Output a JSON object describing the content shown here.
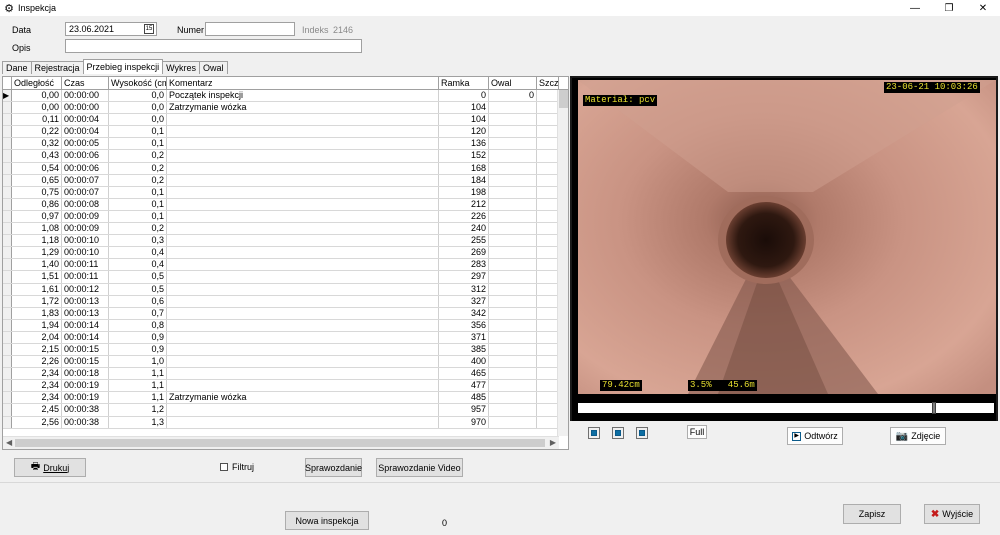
{
  "window": {
    "title": "Inspekcja",
    "minimize": "—",
    "restore": "❐",
    "close": "✕"
  },
  "header": {
    "data_label": "Data",
    "data_value": "23.06.2021",
    "numer_label": "Numer",
    "numer_value": "",
    "indeks_label": "Indeks",
    "indeks_value": "2146",
    "opis_label": "Opis",
    "opis_value": ""
  },
  "tabs": [
    "Dane",
    "Rejestracja",
    "Przebieg inspekcji",
    "Wykres",
    "Owal"
  ],
  "grid": {
    "columns": [
      "Odległość",
      "Czas",
      "Wysokość (cm)",
      "Komentarz",
      "Ramka",
      "Owal",
      "Szcz"
    ],
    "rows": [
      [
        "0,00",
        "00:00:00",
        "0,0",
        "Początek inspekcji",
        "0",
        "0"
      ],
      [
        "0,00",
        "00:00:00",
        "0,0",
        "Zatrzymanie wózka",
        "104",
        ""
      ],
      [
        "0,11",
        "00:00:04",
        "0,0",
        "",
        "104",
        ""
      ],
      [
        "0,22",
        "00:00:04",
        "0,1",
        "",
        "120",
        ""
      ],
      [
        "0,32",
        "00:00:05",
        "0,1",
        "",
        "136",
        ""
      ],
      [
        "0,43",
        "00:00:06",
        "0,2",
        "",
        "152",
        ""
      ],
      [
        "0,54",
        "00:00:06",
        "0,2",
        "",
        "168",
        ""
      ],
      [
        "0,65",
        "00:00:07",
        "0,2",
        "",
        "184",
        ""
      ],
      [
        "0,75",
        "00:00:07",
        "0,1",
        "",
        "198",
        ""
      ],
      [
        "0,86",
        "00:00:08",
        "0,1",
        "",
        "212",
        ""
      ],
      [
        "0,97",
        "00:00:09",
        "0,1",
        "",
        "226",
        ""
      ],
      [
        "1,08",
        "00:00:09",
        "0,2",
        "",
        "240",
        ""
      ],
      [
        "1,18",
        "00:00:10",
        "0,3",
        "",
        "255",
        ""
      ],
      [
        "1,29",
        "00:00:10",
        "0,4",
        "",
        "269",
        ""
      ],
      [
        "1,40",
        "00:00:11",
        "0,4",
        "",
        "283",
        ""
      ],
      [
        "1,51",
        "00:00:11",
        "0,5",
        "",
        "297",
        ""
      ],
      [
        "1,61",
        "00:00:12",
        "0,5",
        "",
        "312",
        ""
      ],
      [
        "1,72",
        "00:00:13",
        "0,6",
        "",
        "327",
        ""
      ],
      [
        "1,83",
        "00:00:13",
        "0,7",
        "",
        "342",
        ""
      ],
      [
        "1,94",
        "00:00:14",
        "0,8",
        "",
        "356",
        ""
      ],
      [
        "2,04",
        "00:00:14",
        "0,9",
        "",
        "371",
        ""
      ],
      [
        "2,15",
        "00:00:15",
        "0,9",
        "",
        "385",
        ""
      ],
      [
        "2,26",
        "00:00:15",
        "1,0",
        "",
        "400",
        ""
      ],
      [
        "2,34",
        "00:00:18",
        "1,1",
        "",
        "465",
        ""
      ],
      [
        "2,34",
        "00:00:19",
        "1,1",
        "",
        "477",
        ""
      ],
      [
        "2,34",
        "00:00:19",
        "1,1",
        "Zatrzymanie wózka",
        "485",
        ""
      ],
      [
        "2,45",
        "00:00:38",
        "1,2",
        "",
        "957",
        ""
      ],
      [
        "2,56",
        "00:00:38",
        "1,3",
        "",
        "970",
        ""
      ]
    ]
  },
  "video": {
    "material": "Materiał: pcv",
    "timestamp": "23-06-21 10:03:26",
    "distance": "79.42cm",
    "slope": "3.5%   45.6m",
    "seek_fraction": 0.86
  },
  "video_controls": {
    "full_label": "Full",
    "odtworz_label": "Odtwórz",
    "zdjecie_label": "Zdjęcie"
  },
  "bottom": {
    "drukuj_label": "Drukuj",
    "filtruj_label": "Filtruj",
    "sprawozdanie_label": "Sprawozdanie",
    "sprawozdanie_video_label": "Sprawozdanie Video",
    "nowa_inspekcja_label": "Nowa inspekcja",
    "counter": "0",
    "zapisz_label": "Zapisz",
    "wyjscie_label": "Wyjście"
  }
}
